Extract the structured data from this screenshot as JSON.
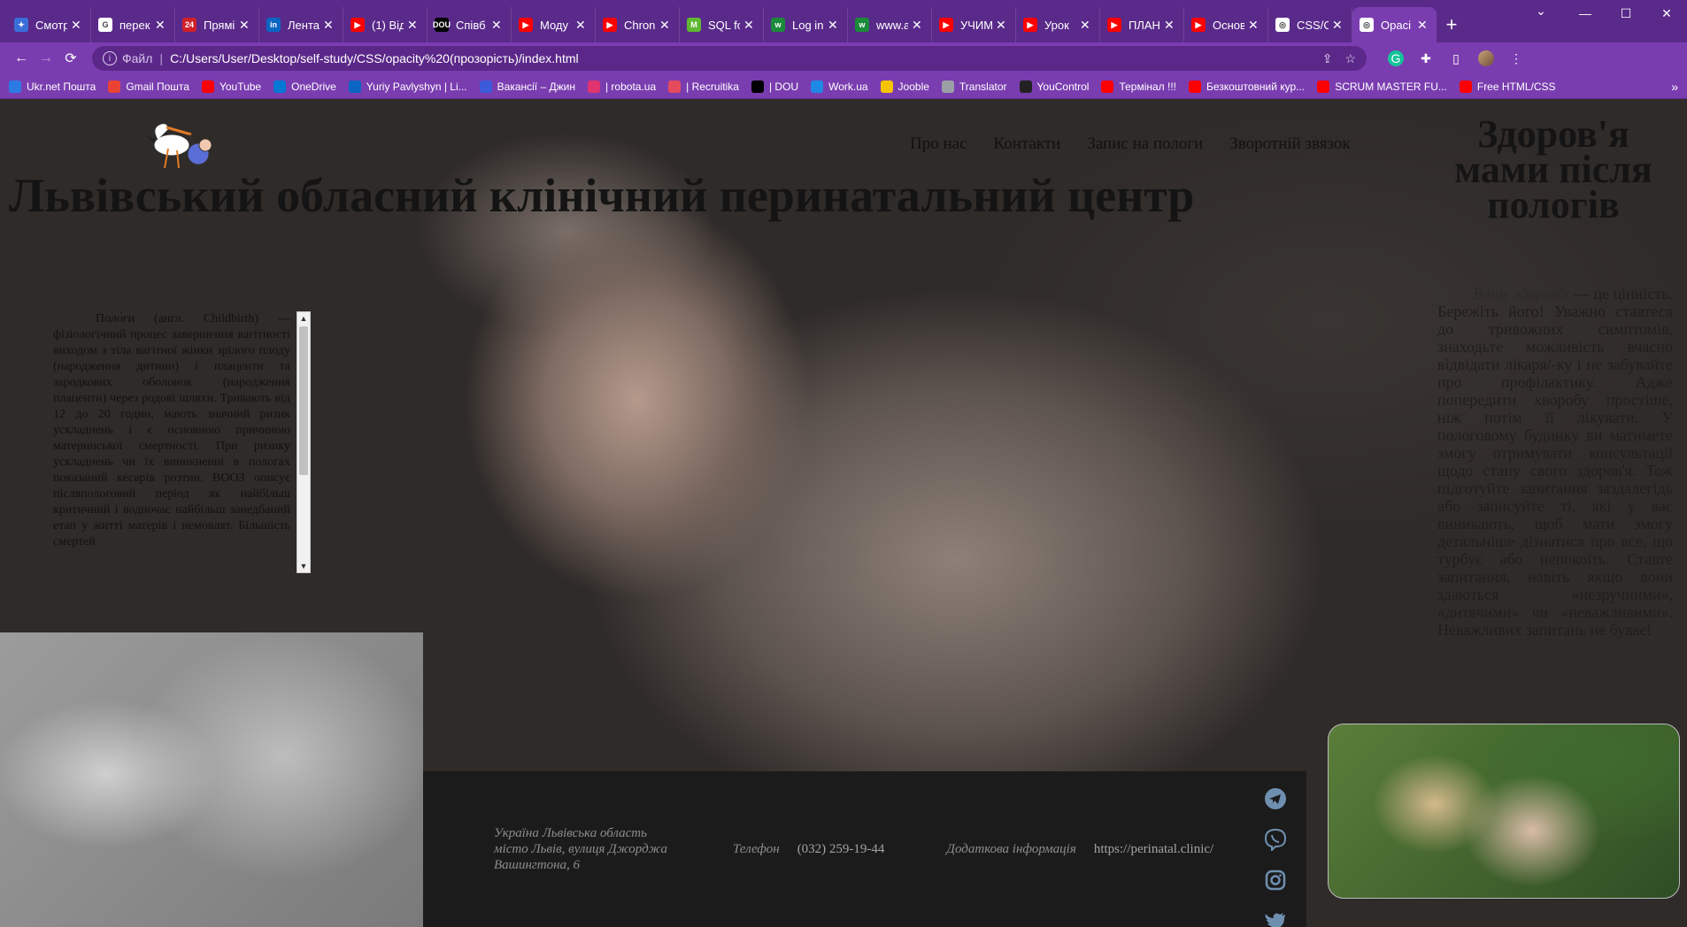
{
  "tabs": [
    {
      "label": "Смотр",
      "fav_bg": "#3a6fd8",
      "fav_glyph": "✦"
    },
    {
      "label": "перек",
      "fav_bg": "#ffffff",
      "fav_glyph": "G"
    },
    {
      "label": "Прямі",
      "fav_bg": "#d0202a",
      "fav_glyph": "24"
    },
    {
      "label": "Лента",
      "fav_bg": "#0a66c2",
      "fav_glyph": "in"
    },
    {
      "label": "(1) Від",
      "fav_bg": "#ff0000",
      "fav_glyph": "▶"
    },
    {
      "label": "Співб",
      "fav_bg": "#000000",
      "fav_glyph": "DOU"
    },
    {
      "label": "Моду",
      "fav_bg": "#ff0000",
      "fav_glyph": "▶"
    },
    {
      "label": "Chron",
      "fav_bg": "#ff0000",
      "fav_glyph": "▶"
    },
    {
      "label": "SQL fo",
      "fav_bg": "#5fb832",
      "fav_glyph": "M"
    },
    {
      "label": "Log in",
      "fav_bg": "#1b8a3a",
      "fav_glyph": "w"
    },
    {
      "label": "www.a",
      "fav_bg": "#1b8a3a",
      "fav_glyph": "w"
    },
    {
      "label": "УЧИМ",
      "fav_bg": "#ff0000",
      "fav_glyph": "▶"
    },
    {
      "label": "Урок",
      "fav_bg": "#ff0000",
      "fav_glyph": "▶"
    },
    {
      "label": "ПЛАН",
      "fav_bg": "#ff0000",
      "fav_glyph": "▶"
    },
    {
      "label": "Основ",
      "fav_bg": "#ff0000",
      "fav_glyph": "▶"
    },
    {
      "label": "CSS/O",
      "fav_bg": "#ffffff",
      "fav_glyph": "◎"
    },
    {
      "label": "Opaci",
      "fav_bg": "#ffffff",
      "fav_glyph": "◎",
      "active": true
    }
  ],
  "toolbar": {
    "scheme_label": "Файл",
    "url": "C:/Users/User/Desktop/self-study/CSS/opacity%20(прозорість)/index.html"
  },
  "bookmarks": [
    {
      "label": "Ukr.net Пошта",
      "color": "#2c7be5"
    },
    {
      "label": "Gmail Пошта",
      "color": "#ea4335"
    },
    {
      "label": "YouTube",
      "color": "#ff0000"
    },
    {
      "label": "OneDrive",
      "color": "#0078d4"
    },
    {
      "label": "Yuriy Pavlyshyn | Li...",
      "color": "#0a66c2"
    },
    {
      "label": "Вакансії – Джин",
      "color": "#3b5bdb"
    },
    {
      "label": "| robota.ua",
      "color": "#e0336f"
    },
    {
      "label": "| Recruitika",
      "color": "#e64a5d"
    },
    {
      "label": "| DOU",
      "color": "#000000"
    },
    {
      "label": "Work.ua",
      "color": "#1e88e5"
    },
    {
      "label": "Jooble",
      "color": "#f5c400"
    },
    {
      "label": "Translator",
      "color": "#9aa0a6"
    },
    {
      "label": "YouControl",
      "color": "#222222"
    },
    {
      "label": "Термінал !!!",
      "color": "#ff0000"
    },
    {
      "label": "Безкоштовний кур...",
      "color": "#ff0000"
    },
    {
      "label": "SCRUM MASTER FU...",
      "color": "#ff0000"
    },
    {
      "label": "Free HTML/CSS",
      "color": "#ff0000"
    }
  ],
  "page": {
    "nav": [
      "Про нас",
      "Контакти",
      "Запис на пологи",
      "Зворотній звязок"
    ],
    "main_title": "Львівський обласний клінічний перинатальний центр",
    "right_title": "Здоров'я мами після пологів",
    "scroll_text": "Поло́ги (англ. Childbirth) — фізіологічний процес завершення вагітності виходом з тіла вагітної жінки зрілого плоду (народження дитини) і плаценти та зародкових оболонок (народження плаценти) через родові шляхи. Тривають від 12 до 20 годин, мають значний ризик ускладнень і є основною причиною материнської смертності. При ризику ускладнень чи їх виникненні в пологах показаний кесарів розтин. ВООЗ описує післяпологовий період як найбільш критичний і водночас найбільш занедбаний етап у житті матерів і немовлят. Більшість смертей",
    "right_text_italic": "Ваше здоров'я",
    "right_text_rest": " — це цінність. Бережіть його! Уважно ставтеся до тривожних симптомів, знаходьте можливість вчасно відвідати лікаря/-ку і не забувайте про профілактику. Адже попередити хворобу простіше, ніж потім її лікувати. У пологовому будинку ви матимете змогу отримувати консультації щодо стану свого здоров'я. Тож підготуйте запитання заздалегідь або записуйте ті, які у вас виникають, щоб мати змогу детальніше дізнатися про все, що турбує або непокоїть. Ставте запитання, навіть якщо вони здаються «незручними», «дитячими» чи «неважливими». Неважливих запитань не буває!"
  },
  "footer": {
    "address": "Україна Львівська область місто Львів, вулиця Джорджа Вашингтона, 6",
    "phone_label": "Телефон",
    "phone": "(032) 259-19-44",
    "info_label": "Додаткова інформація",
    "site": "https://perinatal.clinic/"
  },
  "icons": {
    "social": [
      "telegram-icon",
      "viber-icon",
      "instagram-icon",
      "twitter-icon"
    ]
  },
  "colors": {
    "tabstrip": "#5a2a8a",
    "toolbar": "#7a3db0",
    "footer_bg": "#1b1b1b",
    "social_icon": "#6f8fb0"
  }
}
